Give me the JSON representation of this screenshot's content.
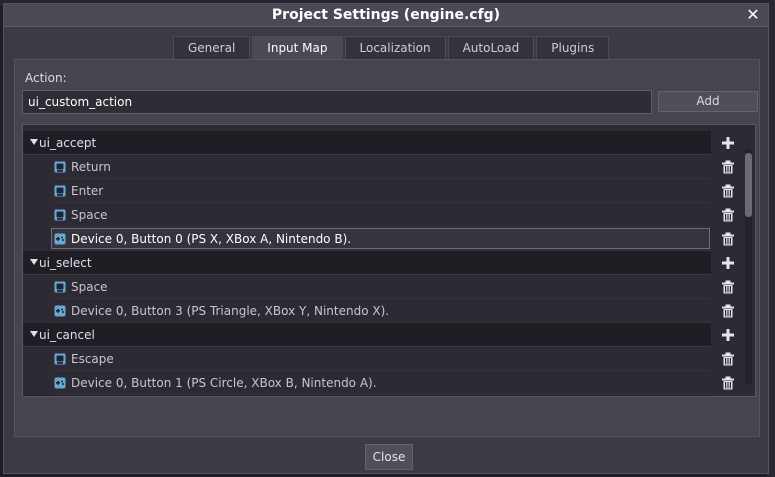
{
  "window": {
    "title": "Project Settings (engine.cfg)",
    "close_symbol": "✕"
  },
  "tabs": [
    {
      "label": "General",
      "active": false
    },
    {
      "label": "Input Map",
      "active": true
    },
    {
      "label": "Localization",
      "active": false
    },
    {
      "label": "AutoLoad",
      "active": false
    },
    {
      "label": "Plugins",
      "active": false
    }
  ],
  "input_map": {
    "action_label": "Action:",
    "action_value": "ui_custom_action",
    "add_label": "Add",
    "actions": [
      {
        "name": "ui_accept",
        "events": [
          {
            "type": "key",
            "label": "Return"
          },
          {
            "type": "key",
            "label": "Enter"
          },
          {
            "type": "key",
            "label": "Space"
          },
          {
            "type": "joypad",
            "label": "Device 0, Button 0 (PS X, XBox A, Nintendo B).",
            "selected": true
          }
        ]
      },
      {
        "name": "ui_select",
        "events": [
          {
            "type": "key",
            "label": "Space"
          },
          {
            "type": "joypad",
            "label": "Device 0, Button 3 (PS Triangle, XBox Y, Nintendo X)."
          }
        ]
      },
      {
        "name": "ui_cancel",
        "events": [
          {
            "type": "key",
            "label": "Escape"
          },
          {
            "type": "joypad",
            "label": "Device 0, Button 1 (PS Circle, XBox B, Nintendo A)."
          }
        ]
      }
    ]
  },
  "icons": {
    "expand": "arrow-down-icon",
    "add_event": "plus-icon",
    "remove_event": "trash-icon",
    "key": "keyboard-key-icon",
    "joypad": "gamepad-icon"
  },
  "footer": {
    "close_label": "Close"
  },
  "colors": {
    "background": "#3c3b45",
    "titlebar": "#4a4954",
    "tree": "#2c2b33",
    "accent": "#6aa8d8"
  }
}
